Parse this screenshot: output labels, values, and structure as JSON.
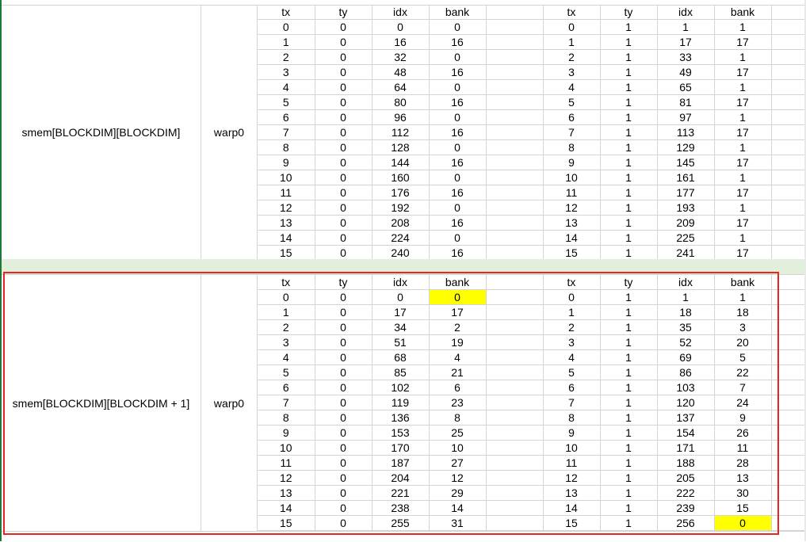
{
  "colors": {
    "highlight": "#ffff00",
    "frame": "#e8251e",
    "gap_row": "#e2efda"
  },
  "sections": [
    {
      "label": "smem[BLOCKDIM][BLOCKDIM]",
      "warp": "warp0",
      "headers": [
        "tx",
        "ty",
        "idx",
        "bank",
        "",
        "tx",
        "ty",
        "idx",
        "bank",
        ""
      ],
      "rows": [
        [
          "0",
          "0",
          "0",
          "0",
          "",
          "0",
          "1",
          "1",
          "1",
          ""
        ],
        [
          "1",
          "0",
          "16",
          "16",
          "",
          "1",
          "1",
          "17",
          "17",
          ""
        ],
        [
          "2",
          "0",
          "32",
          "0",
          "",
          "2",
          "1",
          "33",
          "1",
          ""
        ],
        [
          "3",
          "0",
          "48",
          "16",
          "",
          "3",
          "1",
          "49",
          "17",
          ""
        ],
        [
          "4",
          "0",
          "64",
          "0",
          "",
          "4",
          "1",
          "65",
          "1",
          ""
        ],
        [
          "5",
          "0",
          "80",
          "16",
          "",
          "5",
          "1",
          "81",
          "17",
          ""
        ],
        [
          "6",
          "0",
          "96",
          "0",
          "",
          "6",
          "1",
          "97",
          "1",
          ""
        ],
        [
          "7",
          "0",
          "112",
          "16",
          "",
          "7",
          "1",
          "113",
          "17",
          ""
        ],
        [
          "8",
          "0",
          "128",
          "0",
          "",
          "8",
          "1",
          "129",
          "1",
          ""
        ],
        [
          "9",
          "0",
          "144",
          "16",
          "",
          "9",
          "1",
          "145",
          "17",
          ""
        ],
        [
          "10",
          "0",
          "160",
          "0",
          "",
          "10",
          "1",
          "161",
          "1",
          ""
        ],
        [
          "11",
          "0",
          "176",
          "16",
          "",
          "11",
          "1",
          "177",
          "17",
          ""
        ],
        [
          "12",
          "0",
          "192",
          "0",
          "",
          "12",
          "1",
          "193",
          "1",
          ""
        ],
        [
          "13",
          "0",
          "208",
          "16",
          "",
          "13",
          "1",
          "209",
          "17",
          ""
        ],
        [
          "14",
          "0",
          "224",
          "0",
          "",
          "14",
          "1",
          "225",
          "1",
          ""
        ],
        [
          "15",
          "0",
          "240",
          "16",
          "",
          "15",
          "1",
          "241",
          "17",
          ""
        ]
      ],
      "highlight_cells": []
    },
    {
      "label": "smem[BLOCKDIM][BLOCKDIM + 1]",
      "warp": "warp0",
      "headers": [
        "tx",
        "ty",
        "idx",
        "bank",
        "",
        "tx",
        "ty",
        "idx",
        "bank",
        ""
      ],
      "rows": [
        [
          "0",
          "0",
          "0",
          "0",
          "",
          "0",
          "1",
          "1",
          "1",
          ""
        ],
        [
          "1",
          "0",
          "17",
          "17",
          "",
          "1",
          "1",
          "18",
          "18",
          ""
        ],
        [
          "2",
          "0",
          "34",
          "2",
          "",
          "2",
          "1",
          "35",
          "3",
          ""
        ],
        [
          "3",
          "0",
          "51",
          "19",
          "",
          "3",
          "1",
          "52",
          "20",
          ""
        ],
        [
          "4",
          "0",
          "68",
          "4",
          "",
          "4",
          "1",
          "69",
          "5",
          ""
        ],
        [
          "5",
          "0",
          "85",
          "21",
          "",
          "5",
          "1",
          "86",
          "22",
          ""
        ],
        [
          "6",
          "0",
          "102",
          "6",
          "",
          "6",
          "1",
          "103",
          "7",
          ""
        ],
        [
          "7",
          "0",
          "119",
          "23",
          "",
          "7",
          "1",
          "120",
          "24",
          ""
        ],
        [
          "8",
          "0",
          "136",
          "8",
          "",
          "8",
          "1",
          "137",
          "9",
          ""
        ],
        [
          "9",
          "0",
          "153",
          "25",
          "",
          "9",
          "1",
          "154",
          "26",
          ""
        ],
        [
          "10",
          "0",
          "170",
          "10",
          "",
          "10",
          "1",
          "171",
          "11",
          ""
        ],
        [
          "11",
          "0",
          "187",
          "27",
          "",
          "11",
          "1",
          "188",
          "28",
          ""
        ],
        [
          "12",
          "0",
          "204",
          "12",
          "",
          "12",
          "1",
          "205",
          "13",
          ""
        ],
        [
          "13",
          "0",
          "221",
          "29",
          "",
          "13",
          "1",
          "222",
          "30",
          ""
        ],
        [
          "14",
          "0",
          "238",
          "14",
          "",
          "14",
          "1",
          "239",
          "15",
          ""
        ],
        [
          "15",
          "0",
          "255",
          "31",
          "",
          "15",
          "1",
          "256",
          "0",
          ""
        ]
      ],
      "highlight_cells": [
        [
          0,
          3
        ],
        [
          15,
          8
        ]
      ]
    }
  ]
}
